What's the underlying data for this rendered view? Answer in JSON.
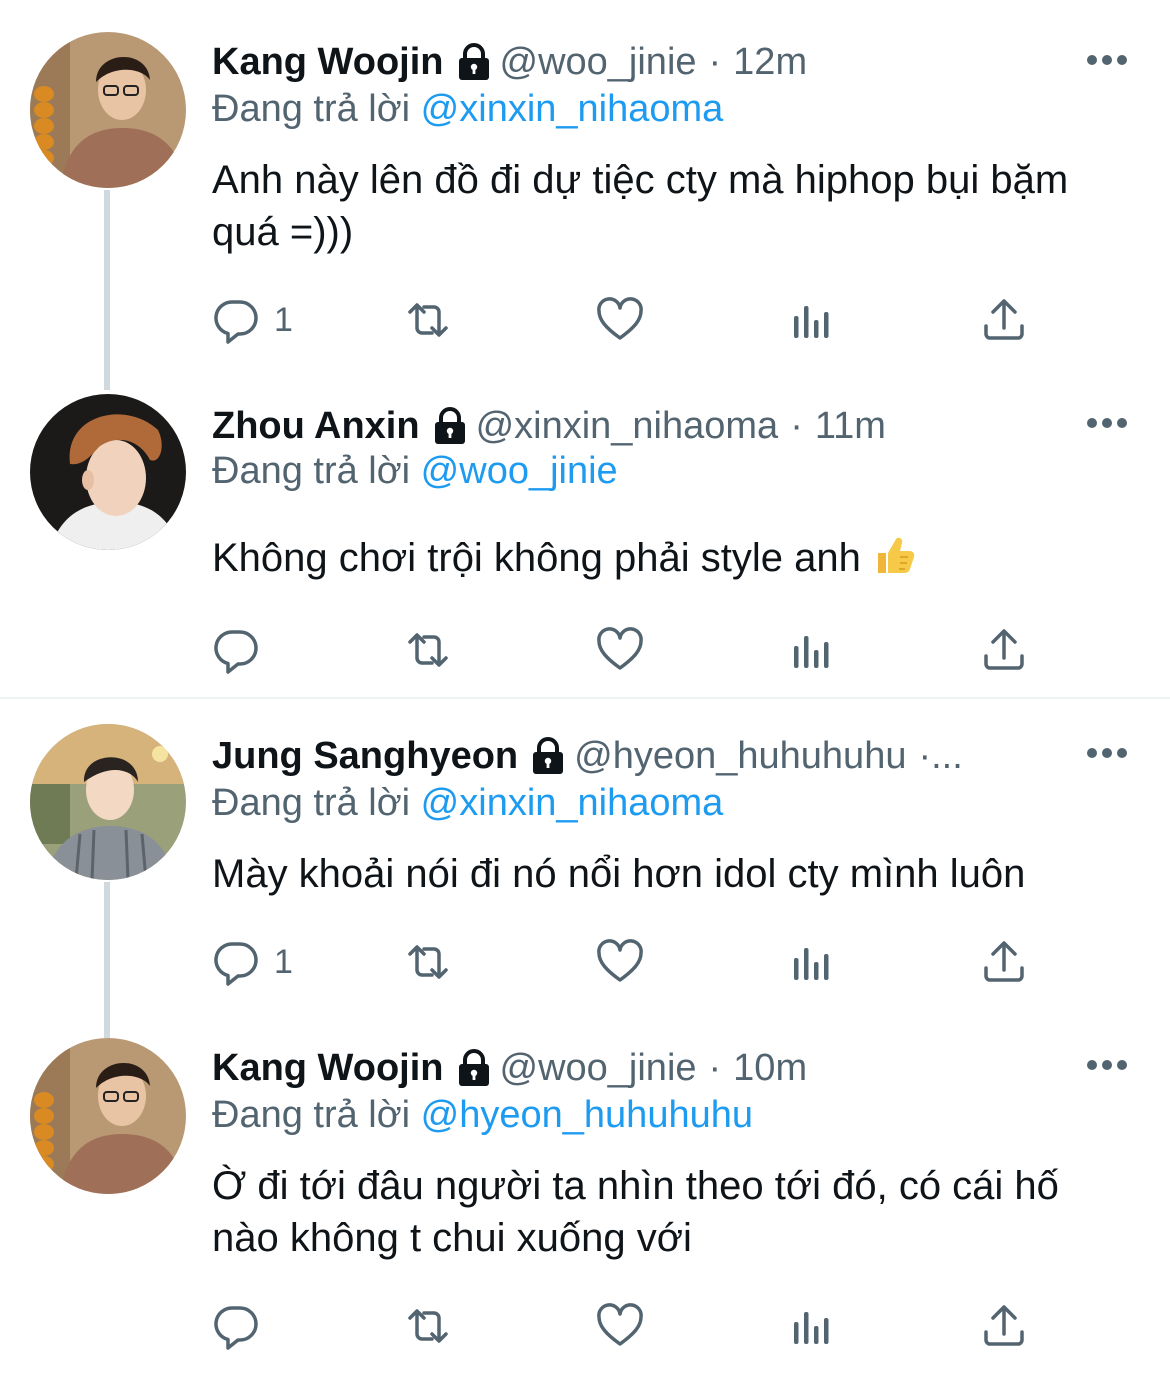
{
  "tweets": [
    {
      "name": "Kang Woojin",
      "handle": "@woo_jinie",
      "separator": "·",
      "time": "12m",
      "replying_prefix": "Đang trả lời",
      "replying_to": "@xinxin_nihaoma",
      "text": "Anh này lên đồ đi dự tiệc cty mà hiphop bụi bặm quá =)))",
      "reply_count": "1",
      "avatar_icon": "profile-photo-kang-woojin"
    },
    {
      "name": "Zhou Anxin",
      "handle": "@xinxin_nihaoma",
      "separator": "·",
      "time": "11m",
      "replying_prefix": "Đang trả lời",
      "replying_to": "@woo_jinie",
      "text": "Không chơi trội không phải style anh",
      "emoji": "thumbs-up",
      "reply_count": "",
      "avatar_icon": "profile-photo-zhou-anxin"
    },
    {
      "name": "Jung Sanghyeon",
      "handle": "@hyeon_huhuhuhu",
      "separator": "·...",
      "time": "",
      "replying_prefix": "Đang trả lời",
      "replying_to": "@xinxin_nihaoma",
      "text": "Mày khoải nói đi nó nổi hơn idol cty mình luôn",
      "reply_count": "1",
      "avatar_icon": "profile-photo-jung-sanghyeon"
    },
    {
      "name": "Kang Woojin",
      "handle": "@woo_jinie",
      "separator": "·",
      "time": "10m",
      "replying_prefix": "Đang trả lời",
      "replying_to": "@hyeon_huhuhuhu",
      "text": "Ờ đi tới đâu người ta nhìn theo tới đó, có cái hố nào không t chui xuống với",
      "reply_count": "",
      "avatar_icon": "profile-photo-kang-woojin"
    }
  ],
  "colors": {
    "text": "#0f1419",
    "secondary": "#536471",
    "link": "#1d9bf0",
    "thread_line": "#cfd9de",
    "divider": "#eff3f4"
  },
  "icons": [
    "lock-icon",
    "more-icon",
    "reply-icon",
    "retweet-icon",
    "like-icon",
    "views-icon",
    "share-icon"
  ]
}
